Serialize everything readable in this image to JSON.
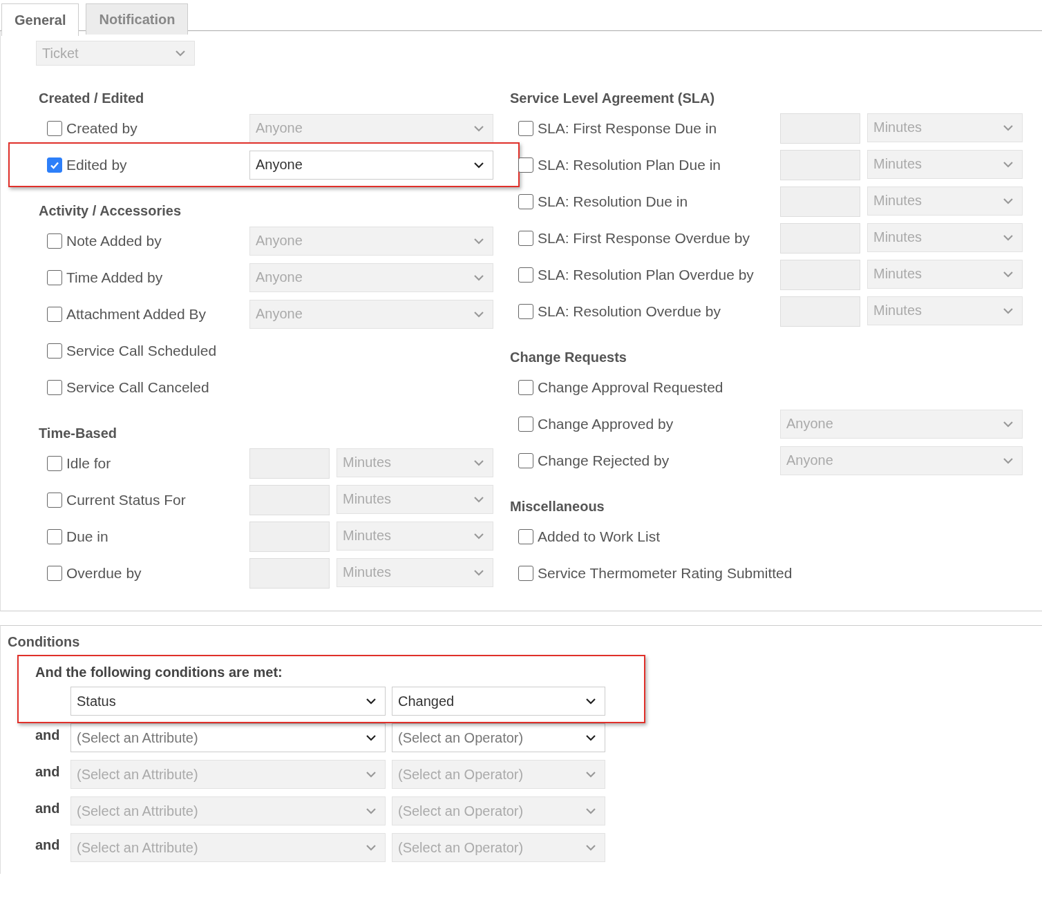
{
  "tabs": [
    {
      "label": "General",
      "selected": true
    },
    {
      "label": "Notification",
      "selected": false
    }
  ],
  "object_type": {
    "value": "Ticket",
    "disabled": true
  },
  "left_sections": [
    {
      "title": "Created / Edited",
      "rows": [
        {
          "kind": "select",
          "label": "Created by",
          "checked": false,
          "value": "Anyone",
          "disabled": true,
          "highlighted": false
        },
        {
          "kind": "select",
          "label": "Edited by",
          "checked": true,
          "value": "Anyone",
          "disabled": false,
          "highlighted": true
        }
      ]
    },
    {
      "title": "Activity / Accessories",
      "rows": [
        {
          "kind": "select",
          "label": "Note Added by",
          "checked": false,
          "value": "Anyone",
          "disabled": true,
          "highlighted": false
        },
        {
          "kind": "select",
          "label": "Time Added by",
          "checked": false,
          "value": "Anyone",
          "disabled": true,
          "highlighted": false
        },
        {
          "kind": "select",
          "label": "Attachment Added By",
          "checked": false,
          "value": "Anyone",
          "disabled": true,
          "highlighted": false
        },
        {
          "kind": "plain",
          "label": "Service Call Scheduled",
          "checked": false,
          "highlighted": false
        },
        {
          "kind": "plain",
          "label": "Service Call Canceled",
          "checked": false,
          "highlighted": false
        }
      ]
    },
    {
      "title": "Time-Based",
      "rows": [
        {
          "kind": "duration",
          "label": "Idle for",
          "checked": false,
          "unit": "Minutes",
          "disabled": true,
          "highlighted": false
        },
        {
          "kind": "duration",
          "label": "Current Status For",
          "checked": false,
          "unit": "Minutes",
          "disabled": true,
          "highlighted": false
        },
        {
          "kind": "duration",
          "label": "Due in",
          "checked": false,
          "unit": "Minutes",
          "disabled": true,
          "highlighted": false
        },
        {
          "kind": "duration",
          "label": "Overdue by",
          "checked": false,
          "unit": "Minutes",
          "disabled": true,
          "highlighted": false
        }
      ]
    }
  ],
  "right_sections": [
    {
      "title": "Service Level Agreement (SLA)",
      "rows": [
        {
          "kind": "duration",
          "label": "SLA: First Response Due in",
          "checked": false,
          "unit": "Minutes",
          "disabled": true,
          "highlighted": false
        },
        {
          "kind": "duration",
          "label": "SLA: Resolution Plan Due in",
          "checked": false,
          "unit": "Minutes",
          "disabled": true,
          "highlighted": false
        },
        {
          "kind": "duration",
          "label": "SLA: Resolution Due in",
          "checked": false,
          "unit": "Minutes",
          "disabled": true,
          "highlighted": false
        },
        {
          "kind": "duration",
          "label": "SLA: First Response Overdue by",
          "checked": false,
          "unit": "Minutes",
          "disabled": true,
          "highlighted": false
        },
        {
          "kind": "duration",
          "label": "SLA: Resolution Plan Overdue by",
          "checked": false,
          "unit": "Minutes",
          "disabled": true,
          "highlighted": false
        },
        {
          "kind": "duration",
          "label": "SLA: Resolution Overdue by",
          "checked": false,
          "unit": "Minutes",
          "disabled": true,
          "highlighted": false
        }
      ]
    },
    {
      "title": "Change Requests",
      "rows": [
        {
          "kind": "plain",
          "label": "Change Approval Requested",
          "checked": false,
          "highlighted": false
        },
        {
          "kind": "select",
          "label": "Change Approved by",
          "checked": false,
          "value": "Anyone",
          "disabled": true,
          "highlighted": false
        },
        {
          "kind": "select",
          "label": "Change Rejected by",
          "checked": false,
          "value": "Anyone",
          "disabled": true,
          "highlighted": false
        }
      ]
    },
    {
      "title": "Miscellaneous",
      "rows": [
        {
          "kind": "plain",
          "label": "Added to Work List",
          "checked": false,
          "highlighted": false
        },
        {
          "kind": "plain",
          "label": "Service Thermometer Rating Submitted",
          "checked": false,
          "highlighted": false
        }
      ]
    }
  ],
  "conditions": {
    "title": "Conditions",
    "intro": "And the following conditions are met:",
    "highlighted": true,
    "rows": [
      {
        "attribute": {
          "value": "Status",
          "disabled": false
        },
        "operator": {
          "value": "Changed",
          "disabled": false
        }
      },
      {
        "joiner": "and",
        "attribute": {
          "placeholder": "(Select an Attribute)",
          "disabled": false
        },
        "operator": {
          "placeholder": "(Select an Operator)",
          "disabled": false
        }
      },
      {
        "joiner": "and",
        "attribute": {
          "placeholder": "(Select an Attribute)",
          "disabled": true
        },
        "operator": {
          "placeholder": "(Select an Operator)",
          "disabled": true
        }
      },
      {
        "joiner": "and",
        "attribute": {
          "placeholder": "(Select an Attribute)",
          "disabled": true
        },
        "operator": {
          "placeholder": "(Select an Operator)",
          "disabled": true
        }
      },
      {
        "joiner": "and",
        "attribute": {
          "placeholder": "(Select an Attribute)",
          "disabled": true
        },
        "operator": {
          "placeholder": "(Select an Operator)",
          "disabled": true
        }
      }
    ]
  }
}
